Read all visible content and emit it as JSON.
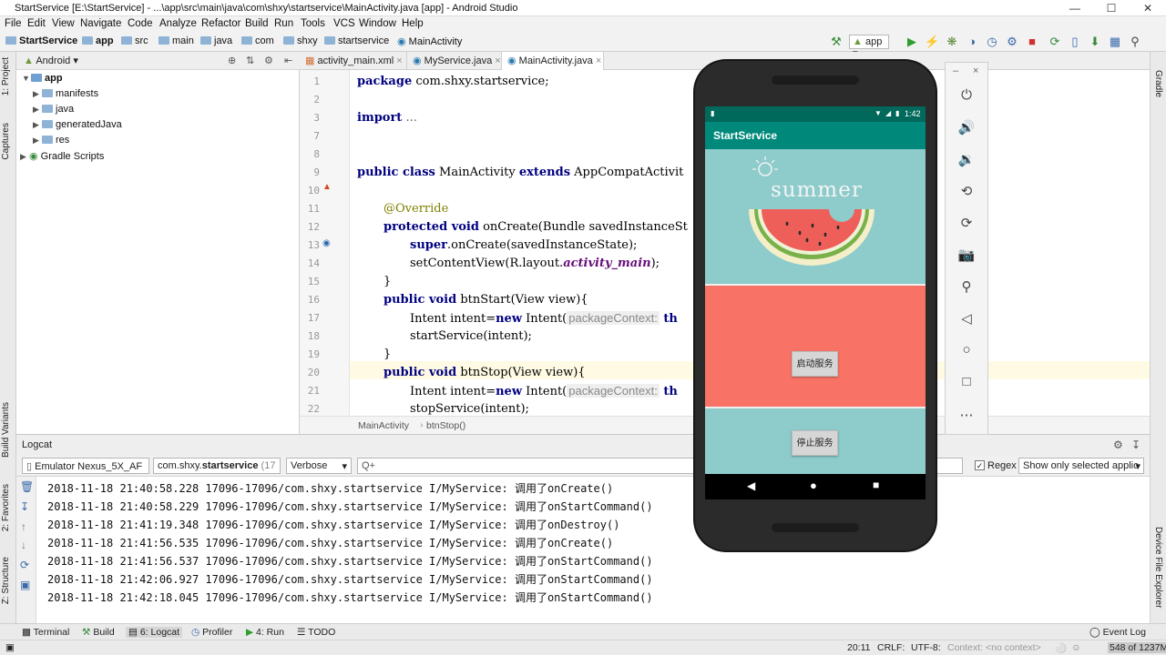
{
  "window": {
    "title": "StartService [E:\\StartService] - ...\\app\\src\\main\\java\\com\\shxy\\startservice\\MainActivity.java [app] - Android Studio"
  },
  "menu": [
    "File",
    "Edit",
    "View",
    "Navigate",
    "Code",
    "Analyze",
    "Refactor",
    "Build",
    "Run",
    "Tools",
    "VCS",
    "Window",
    "Help"
  ],
  "breadcrumb": [
    "StartService",
    "app",
    "src",
    "main",
    "java",
    "com",
    "shxy",
    "startservice",
    "MainActivity"
  ],
  "toolbar": {
    "run_config": "app"
  },
  "left_strip": {
    "project": "1: Project",
    "captures": "Captures",
    "build_variants": "Build Variants",
    "favorites": "2: Favorites",
    "structure": "Z: Structure"
  },
  "right_strip": {
    "gradle": "Gradle",
    "device_file_explorer": "Device File Explorer"
  },
  "project": {
    "view_mode": "Android",
    "tree": [
      {
        "label": "app",
        "level": 0
      },
      {
        "label": "manifests",
        "level": 1
      },
      {
        "label": "java",
        "level": 1
      },
      {
        "label": "generatedJava",
        "level": 1
      },
      {
        "label": "res",
        "level": 1
      },
      {
        "label": "Gradle Scripts",
        "level": 0
      }
    ]
  },
  "editor": {
    "tabs": [
      "activity_main.xml",
      "MyService.java",
      "MainActivity.java"
    ],
    "active_tab": 2,
    "line_numbers": [
      "1",
      "2",
      "3",
      "7",
      "8",
      "9",
      "10",
      "11",
      "12",
      "13",
      "14",
      "15",
      "16",
      "17",
      "18",
      "19",
      "20",
      "21",
      "22"
    ],
    "code": {
      "l1a": "package",
      "l1b": " com.shxy.startservice;",
      "l3a": "import",
      "l3b": " ...",
      "l9a": "public class",
      "l9b": " MainActivity ",
      "l9c": "extends",
      "l9d": " AppCompatActivit",
      "l11": "@Override",
      "l12a": "protected void",
      "l12b": " onCreate(Bundle savedInstanceSt",
      "l13a": "super",
      "l13b": ".onCreate(savedInstanceState);",
      "l14a": "setContentView(R.layout.",
      "l14b": "activity_main",
      "l14c": ");",
      "l15": "}",
      "l16a": "public void",
      "l16b": " btnStart(View view){",
      "l17a": "Intent intent=",
      "l17b": "new",
      "l17c": " Intent(",
      "l17d": "packageContext:",
      "l17e": " th",
      "l18": "startService(intent);",
      "l19": "}",
      "l20a": "public void",
      "l20b": " btnStop(View view){",
      "l21a": "Intent intent=",
      "l21b": "new",
      "l21c": " Intent(",
      "l21d": "packageContext:",
      "l21e": " th",
      "l22": "stopService(intent);"
    },
    "crumbs": [
      "MainActivity",
      "btnStop()"
    ]
  },
  "logcat": {
    "title": "Logcat",
    "device": "Emulator Nexus_5X_AF",
    "process_prefix": "com.shxy.",
    "process_bold": "startservice",
    "process_suffix": " (17",
    "level": "Verbose",
    "search_placeholder": "Q+",
    "regex_label": "Regex",
    "filter": "Show only selected applic",
    "lines": [
      "2018-11-18 21:40:58.228 17096-17096/com.shxy.startservice I/MyService: 调用了onCreate()",
      "2018-11-18 21:40:58.229 17096-17096/com.shxy.startservice I/MyService: 调用了onStartCommand()",
      "2018-11-18 21:41:19.348 17096-17096/com.shxy.startservice I/MyService: 调用了onDestroy()",
      "2018-11-18 21:41:56.535 17096-17096/com.shxy.startservice I/MyService: 调用了onCreate()",
      "2018-11-18 21:41:56.537 17096-17096/com.shxy.startservice I/MyService: 调用了onStartCommand()",
      "2018-11-18 21:42:06.927 17096-17096/com.shxy.startservice I/MyService: 调用了onStartCommand()",
      "2018-11-18 21:42:18.045 17096-17096/com.shxy.startservice I/MyService: 调用了onStartCommand()"
    ]
  },
  "bottom_tools": {
    "terminal": "Terminal",
    "build": "Build",
    "logcat": "6: Logcat",
    "profiler": "Profiler",
    "run": "4: Run",
    "todo": "TODO",
    "event_log": "Event Log"
  },
  "status": {
    "position": "20:11",
    "line_sep": "CRLF:",
    "encoding": "UTF-8:",
    "context": "Context: <no context>",
    "memory": "548 of 1237M"
  },
  "phone": {
    "time": "1:42",
    "app_title": "StartService",
    "banner_text": "summer",
    "start_button": "启动服务",
    "stop_button": "停止服务"
  },
  "colors": {
    "app_bar": "#00897b",
    "status_bar": "#00695c",
    "banner": "#8ecbcb",
    "red_area": "#f87366",
    "keyword": "#000080",
    "annotation": "#808000"
  }
}
